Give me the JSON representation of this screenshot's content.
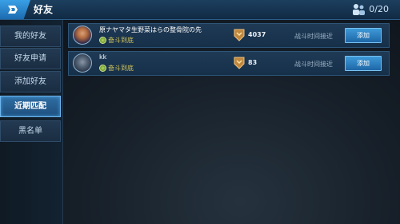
{
  "header": {
    "title": "好友",
    "count": "0/20",
    "back_icon": "back-arrow-icon",
    "friends_icon": "friends-icon"
  },
  "sidebar": {
    "items": [
      {
        "label": "我的好友",
        "active": false
      },
      {
        "label": "好友申请",
        "active": false
      },
      {
        "label": "添加好友",
        "active": false
      },
      {
        "label": "近期匹配",
        "active": true
      },
      {
        "label": "黑名单",
        "active": false
      }
    ]
  },
  "players": [
    {
      "name": "原ナヤマタ生野菜はらの整骨院の先",
      "rank": "奋斗到底",
      "score": "4037",
      "status": "战斗时间接近",
      "button": "添加"
    },
    {
      "name": "kk",
      "rank": "奋斗到底",
      "score": "83",
      "status": "战斗时间接近",
      "button": "添加"
    }
  ],
  "colors": {
    "accent": "#3e9ad8",
    "active_tab": "#2f6ea3",
    "rank_text": "#d8c85a"
  }
}
